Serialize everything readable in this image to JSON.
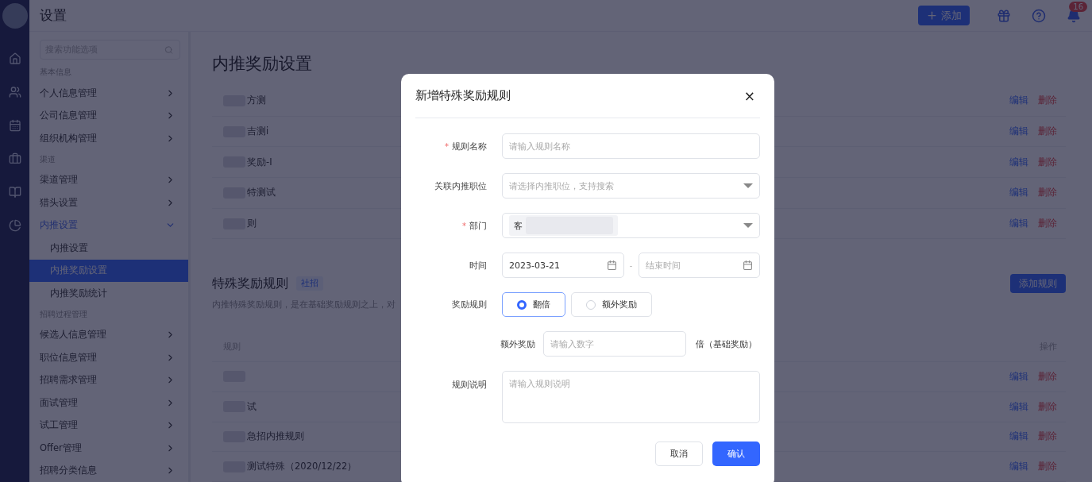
{
  "header": {
    "title": "设置",
    "add_button": "添加",
    "notification_count": "16"
  },
  "sidebar": {
    "search_placeholder": "搜索功能选项",
    "groups": [
      {
        "title": "基本信息",
        "items": [
          {
            "label": "个人信息管理",
            "expanded": false,
            "selected": false
          },
          {
            "label": "公司信息管理",
            "expanded": false,
            "selected": false
          },
          {
            "label": "组织机构管理",
            "expanded": false,
            "selected": false
          }
        ]
      },
      {
        "title": "渠道",
        "items": [
          {
            "label": "渠道管理",
            "expanded": false,
            "selected": false
          },
          {
            "label": "猎头设置",
            "expanded": false,
            "selected": false
          },
          {
            "label": "内推设置",
            "expanded": true,
            "selected": true,
            "children": [
              {
                "label": "内推设置",
                "selected": false
              },
              {
                "label": "内推奖励设置",
                "selected": true
              },
              {
                "label": "内推奖励统计",
                "selected": false
              }
            ]
          }
        ]
      },
      {
        "title": "招聘过程管理",
        "items": [
          {
            "label": "候选人信息管理",
            "expanded": false,
            "selected": false
          },
          {
            "label": "职位信息管理",
            "expanded": false,
            "selected": false
          },
          {
            "label": "招聘需求管理",
            "expanded": false,
            "selected": false
          },
          {
            "label": "面试管理",
            "expanded": false,
            "selected": false
          },
          {
            "label": "试工管理",
            "expanded": false,
            "selected": false
          },
          {
            "label": "Offer管理",
            "expanded": false,
            "selected": false
          },
          {
            "label": "招聘分类信息",
            "expanded": false,
            "selected": false
          }
        ]
      }
    ]
  },
  "main": {
    "title": "内推奖励设置",
    "base_rows": [
      {
        "text": "方测",
        "edit": "编辑",
        "delete": "删除"
      },
      {
        "text": "吉测i",
        "edit": "编辑",
        "delete": "删除"
      },
      {
        "text": "奖励-I",
        "edit": "编辑",
        "delete": "删除"
      },
      {
        "text": "特测试",
        "edit": "编辑",
        "delete": "删除"
      },
      {
        "text": "则",
        "edit": "编辑",
        "delete": "删除"
      }
    ],
    "special": {
      "title": "特殊奖励规则",
      "tag": "社招",
      "description": "内推特殊奖励规则，是在基础奖励规则之上，对",
      "add_button": "添加规则",
      "columns": [
        "规则",
        "操作"
      ],
      "rows": [
        {
          "edit": "编辑",
          "delete": "删除"
        },
        {
          "text": "试",
          "edit": "编辑",
          "delete": "删除"
        },
        {
          "text": "急招内推规则",
          "edit": "编辑",
          "delete": "删除"
        },
        {
          "text": "测试特殊（2020/12/22）",
          "edit": "编辑",
          "delete": "删除"
        }
      ]
    }
  },
  "modal": {
    "title": "新增特殊奖励规则",
    "close": "×",
    "fields": [
      {
        "kind": "text",
        "label": "规则名称",
        "required_mark": "*",
        "placeholder": "请输入规则名称"
      },
      {
        "kind": "select",
        "label": "关联内推职位",
        "placeholder": "请选择内推职位，支持搜索"
      },
      {
        "kind": "select",
        "label": "部门",
        "required_mark": "*",
        "value": "客"
      },
      {
        "kind": "daterange",
        "label": "时间",
        "start": "2023-03-21",
        "separator": "-",
        "end_placeholder": "结束时间"
      },
      {
        "kind": "radio",
        "label": "奖励规则",
        "options": [
          {
            "label": "翻倍",
            "selected": true
          },
          {
            "label": "额外奖励",
            "selected": false
          }
        ]
      },
      {
        "kind": "number",
        "label": "额外奖励",
        "placeholder": "请输入数字",
        "suffix": "倍（基础奖励）"
      },
      {
        "kind": "textarea",
        "label": "规则说明",
        "placeholder": "请输入规则说明"
      }
    ],
    "cancel": "取消",
    "confirm": "确认"
  }
}
